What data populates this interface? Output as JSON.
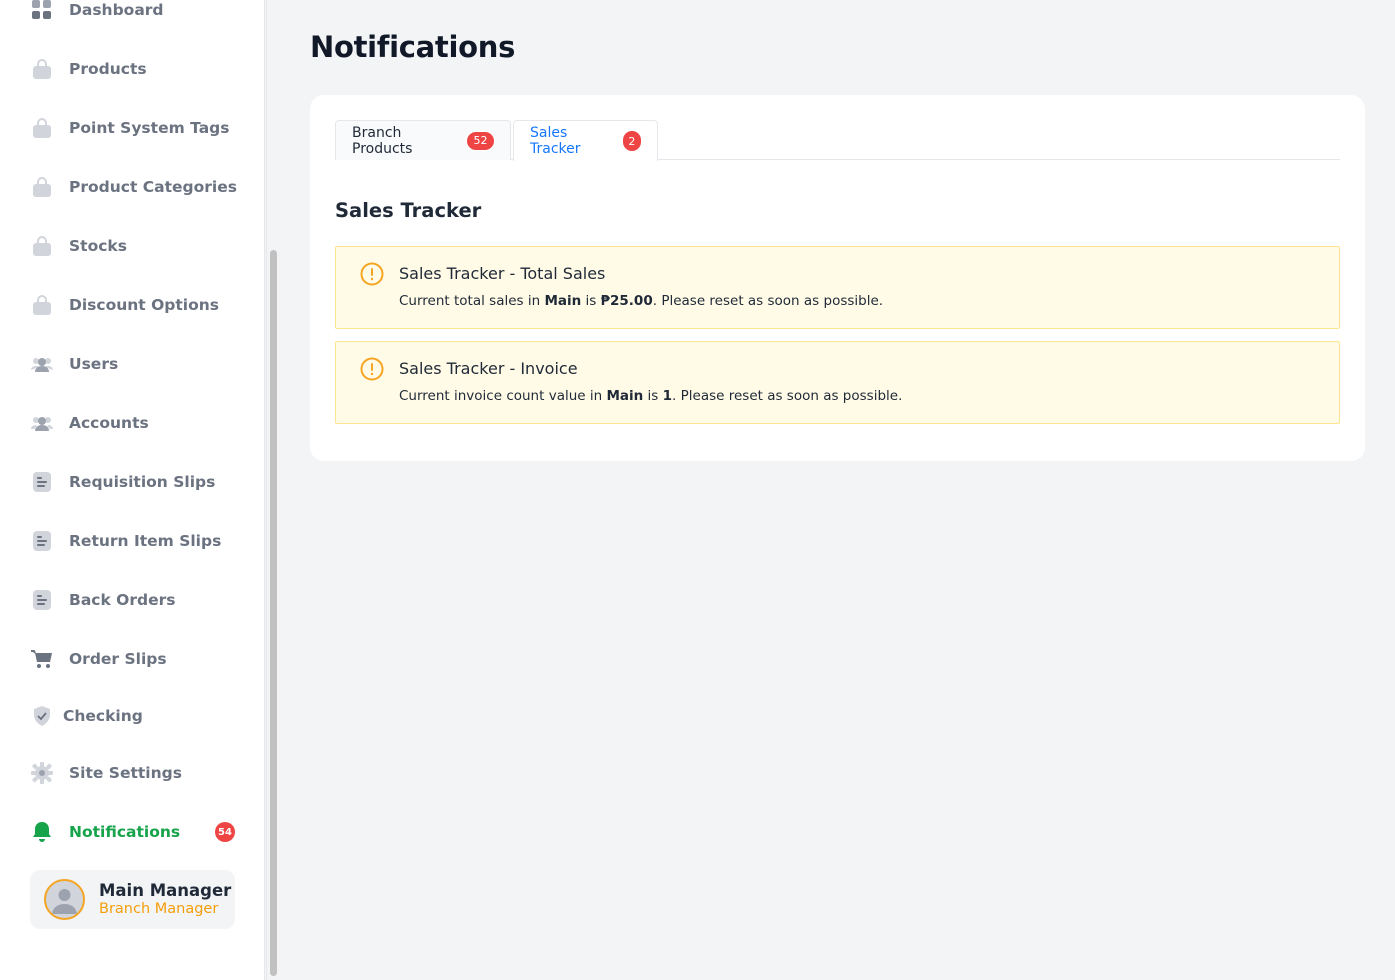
{
  "sidebar": {
    "items": [
      {
        "label": "Dashboard",
        "icon": "dashboard-icon"
      },
      {
        "label": "Products",
        "icon": "bag-icon"
      },
      {
        "label": "Point System Tags",
        "icon": "bag-icon"
      },
      {
        "label": "Product Categories",
        "icon": "bag-icon"
      },
      {
        "label": "Stocks",
        "icon": "bag-icon"
      },
      {
        "label": "Discount Options",
        "icon": "bag-icon"
      },
      {
        "label": "Users",
        "icon": "users-icon"
      },
      {
        "label": "Accounts",
        "icon": "users-icon"
      },
      {
        "label": "Requisition Slips",
        "icon": "document-icon"
      },
      {
        "label": "Return Item Slips",
        "icon": "document-icon"
      },
      {
        "label": "Back Orders",
        "icon": "document-icon"
      },
      {
        "label": "Order Slips",
        "icon": "cart-icon"
      },
      {
        "label": "Checking",
        "icon": "shield-check-icon"
      },
      {
        "label": "Site Settings",
        "icon": "gear-icon"
      },
      {
        "label": "Notifications",
        "icon": "bell-icon",
        "active": true,
        "badge": "54"
      }
    ],
    "user": {
      "name": "Main Manager",
      "role": "Branch Manager"
    }
  },
  "main": {
    "title": "Notifications",
    "tabs": [
      {
        "label": "Branch Products",
        "badge": "52",
        "active": false
      },
      {
        "label": "Sales Tracker",
        "badge": "2",
        "active": true
      }
    ],
    "section_title": "Sales Tracker",
    "alerts": [
      {
        "title": "Sales Tracker - Total Sales",
        "desc_prefix": "Current total sales in ",
        "desc_bold_1": "Main",
        "desc_middle": " is ",
        "desc_bold_2": "₱25.00",
        "desc_suffix": ". Please reset as soon as possible."
      },
      {
        "title": "Sales Tracker - Invoice",
        "desc_prefix": "Current invoice count value in ",
        "desc_bold_1": "Main",
        "desc_middle": " is ",
        "desc_bold_2": "1",
        "desc_suffix": ". Please reset as soon as possible."
      }
    ]
  },
  "colors": {
    "active_green": "#16a34a",
    "tab_blue": "#1677ff",
    "badge_red": "#ef4444",
    "warning": "#f5a524"
  }
}
